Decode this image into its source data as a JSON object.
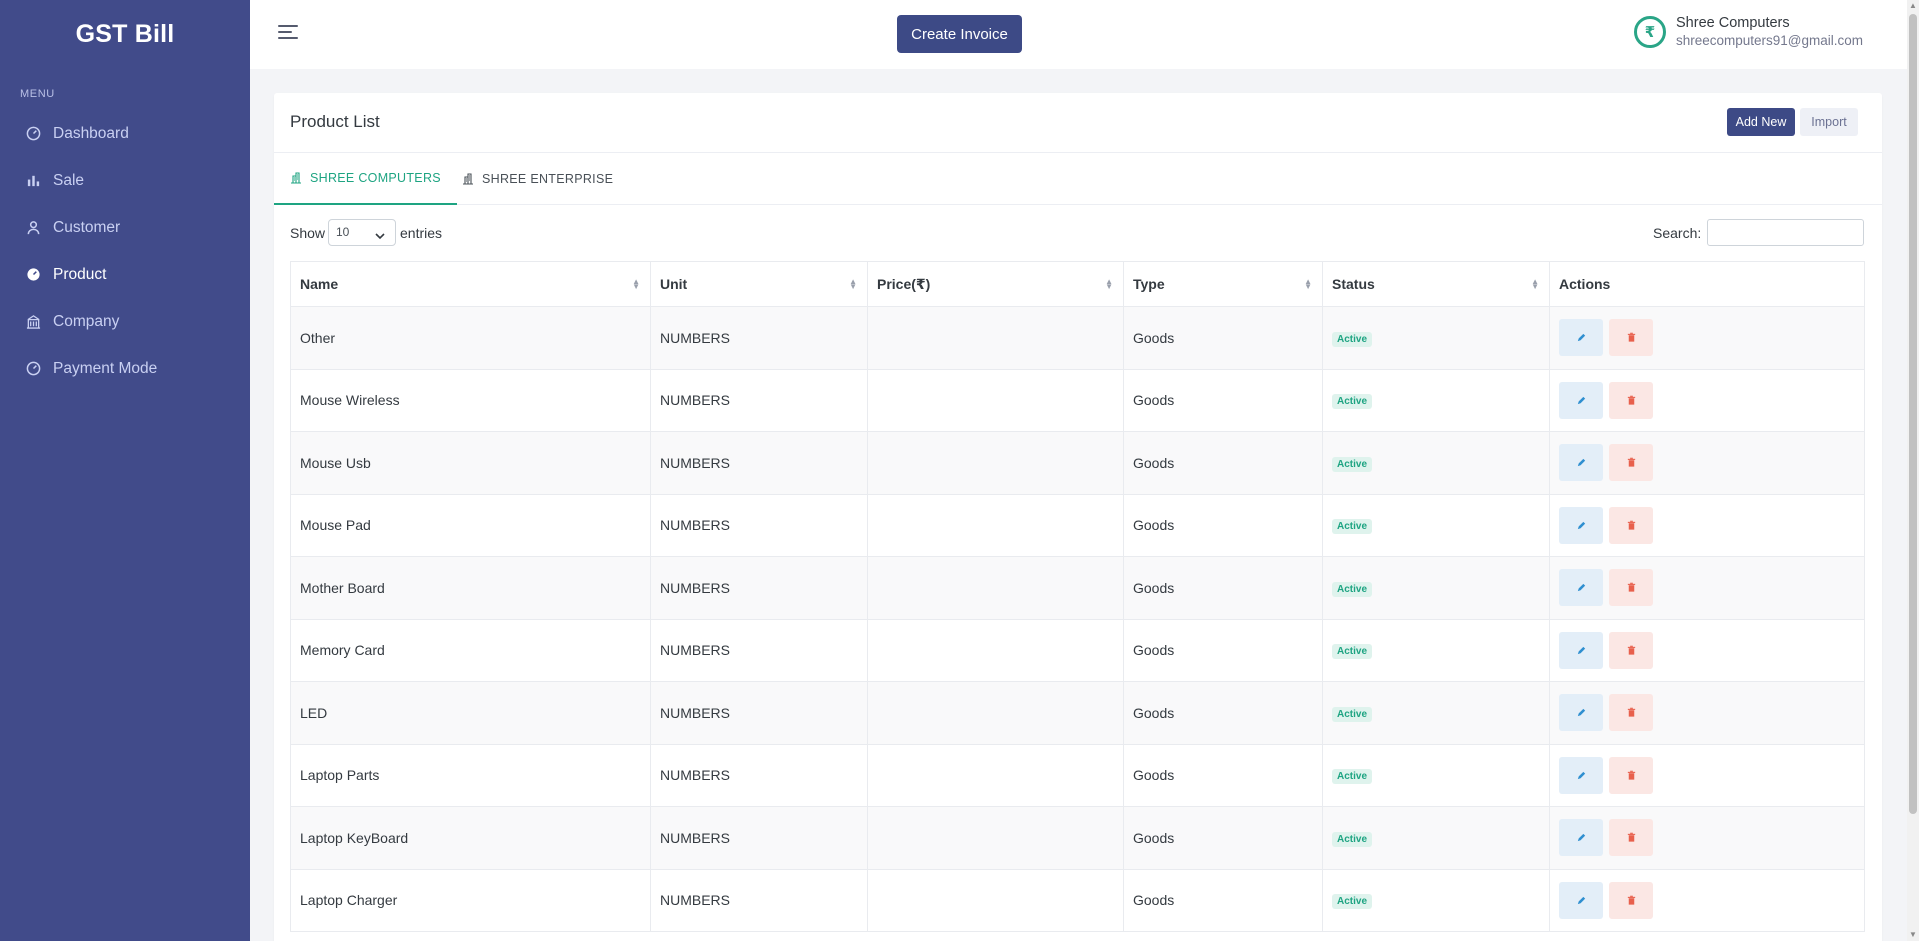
{
  "app": {
    "brand": "GST Bill",
    "create_invoice_label": "Create Invoice"
  },
  "sidebar": {
    "menu_title": "MENU",
    "items": [
      {
        "label": "Dashboard",
        "icon": "dashboard-icon"
      },
      {
        "label": "Sale",
        "icon": "bar-chart-icon"
      },
      {
        "label": "Customer",
        "icon": "user-icon"
      },
      {
        "label": "Product",
        "icon": "product-icon"
      },
      {
        "label": "Company",
        "icon": "building-icon"
      },
      {
        "label": "Payment Mode",
        "icon": "payment-icon"
      }
    ],
    "active": "Product"
  },
  "user": {
    "avatar_glyph": "₹",
    "name": "Shree Computers",
    "email": "shreecomputers91@gmail.com"
  },
  "card": {
    "title": "Product List",
    "add_new_label": "Add New",
    "import_label": "Import"
  },
  "tabs": [
    {
      "label": "SHREE COMPUTERS",
      "active": true
    },
    {
      "label": "SHREE ENTERPRISE",
      "active": false
    }
  ],
  "controls": {
    "show_label": "Show",
    "entries_value": "10",
    "entries_label": "entries",
    "search_label": "Search:",
    "search_value": ""
  },
  "table": {
    "headers": [
      "Name",
      "Unit",
      "Price(₹)",
      "Type",
      "Status",
      "Actions"
    ],
    "rows": [
      {
        "name": "Other",
        "unit": "NUMBERS",
        "price": "",
        "type": "Goods",
        "status": "Active"
      },
      {
        "name": "Mouse Wireless",
        "unit": "NUMBERS",
        "price": "",
        "type": "Goods",
        "status": "Active"
      },
      {
        "name": "Mouse Usb",
        "unit": "NUMBERS",
        "price": "",
        "type": "Goods",
        "status": "Active"
      },
      {
        "name": "Mouse Pad",
        "unit": "NUMBERS",
        "price": "",
        "type": "Goods",
        "status": "Active"
      },
      {
        "name": "Mother Board",
        "unit": "NUMBERS",
        "price": "",
        "type": "Goods",
        "status": "Active"
      },
      {
        "name": "Memory Card",
        "unit": "NUMBERS",
        "price": "",
        "type": "Goods",
        "status": "Active"
      },
      {
        "name": "LED",
        "unit": "NUMBERS",
        "price": "",
        "type": "Goods",
        "status": "Active"
      },
      {
        "name": "Laptop Parts",
        "unit": "NUMBERS",
        "price": "",
        "type": "Goods",
        "status": "Active"
      },
      {
        "name": "Laptop KeyBoard",
        "unit": "NUMBERS",
        "price": "",
        "type": "Goods",
        "status": "Active"
      },
      {
        "name": "Laptop Charger",
        "unit": "NUMBERS",
        "price": "",
        "type": "Goods",
        "status": "Active"
      }
    ]
  },
  "colors": {
    "sidebar_bg": "#414b8a",
    "primary": "#3d4a86",
    "accent_green": "#1ea482",
    "delete_red": "#e8604c",
    "edit_blue": "#2f8fd0"
  }
}
